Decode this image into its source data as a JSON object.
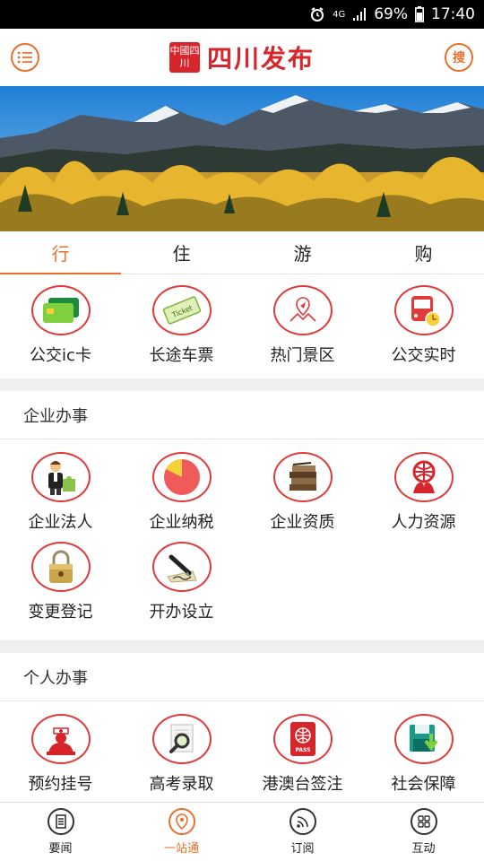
{
  "status_bar": {
    "network": "4G",
    "battery": "69%",
    "time": "17:40"
  },
  "header": {
    "title": "四川发布",
    "seal_text": "中國四川",
    "search_label": "搜"
  },
  "tabs": [
    {
      "label": "行",
      "active": true
    },
    {
      "label": "住",
      "active": false
    },
    {
      "label": "游",
      "active": false
    },
    {
      "label": "购",
      "active": false
    }
  ],
  "travel_items": [
    {
      "label": "公交ic卡",
      "icon": "bus-card-icon"
    },
    {
      "label": "长途车票",
      "icon": "ticket-icon"
    },
    {
      "label": "热门景区",
      "icon": "map-pin-icon"
    },
    {
      "label": "公交实时",
      "icon": "bus-clock-icon"
    }
  ],
  "enterprise": {
    "title": "企业办事",
    "items": [
      {
        "label": "企业法人",
        "icon": "businessman-icon"
      },
      {
        "label": "企业纳税",
        "icon": "pie-chart-icon"
      },
      {
        "label": "企业资质",
        "icon": "books-icon"
      },
      {
        "label": "人力资源",
        "icon": "people-globe-icon"
      },
      {
        "label": "变更登记",
        "icon": "padlock-icon"
      },
      {
        "label": "开办设立",
        "icon": "pen-sign-icon"
      }
    ]
  },
  "personal": {
    "title": "个人办事",
    "items": [
      {
        "label": "预约挂号",
        "icon": "nurse-icon"
      },
      {
        "label": "高考录取",
        "icon": "magnifier-doc-icon"
      },
      {
        "label": "港澳台签注",
        "icon": "passport-icon"
      },
      {
        "label": "社会保障",
        "icon": "floppy-save-icon"
      }
    ],
    "passport_text": "PASS"
  },
  "ticket_text": "Ticket",
  "bottom_nav": [
    {
      "label": "要闻",
      "icon": "document-icon",
      "active": false
    },
    {
      "label": "一站通",
      "icon": "location-icon",
      "active": true
    },
    {
      "label": "订阅",
      "icon": "rss-icon",
      "active": false
    },
    {
      "label": "互动",
      "icon": "grid-icon",
      "active": false
    }
  ]
}
